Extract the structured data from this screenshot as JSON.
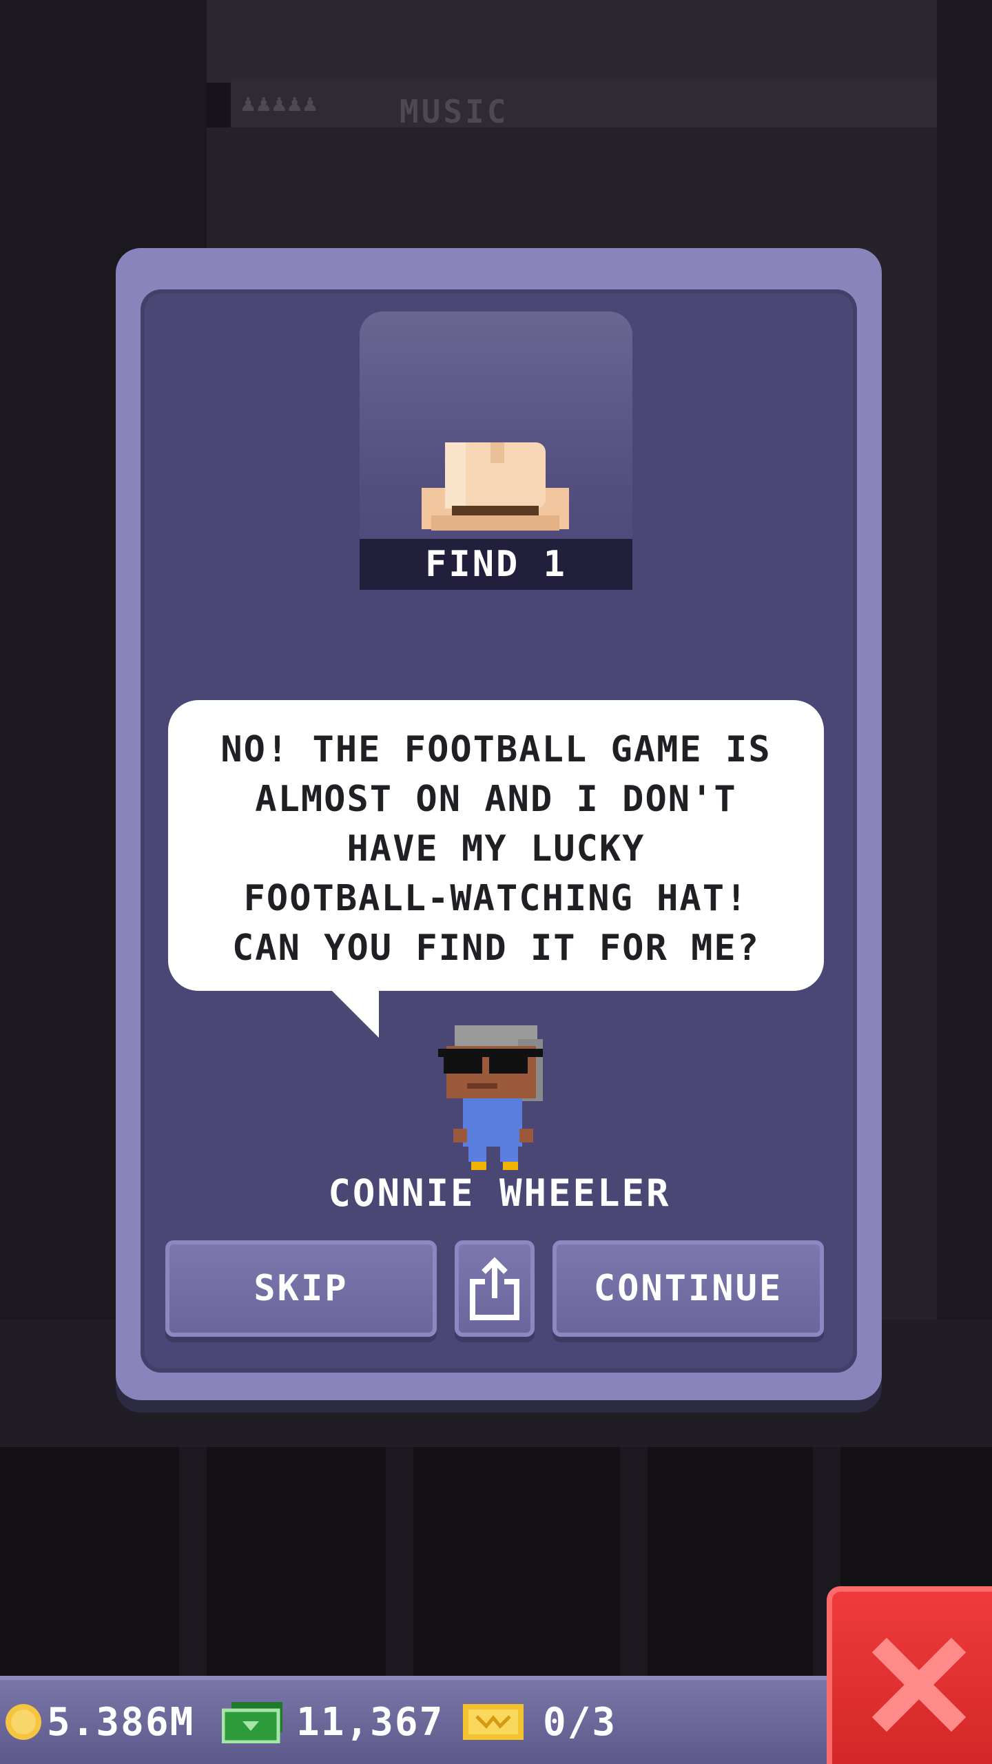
{
  "background": {
    "floor_label": "MUSIC",
    "floor_people": "♟♟♟♟♟"
  },
  "quest": {
    "item_icon": "cowboy-hat-icon",
    "find_label": "FIND 1",
    "dialogue": "NO! THE FOOTBALL GAME IS\nALMOST ON AND I DON'T\nHAVE MY LUCKY\nFOOTBALL-WATCHING HAT!\nCAN YOU FIND IT FOR ME?",
    "npc_name": "CONNIE WHEELER"
  },
  "buttons": {
    "skip": "SKIP",
    "share_icon": "share-icon",
    "continue": "CONTINUE"
  },
  "status_bar": {
    "coins": "5.386M",
    "bux": "11,367",
    "tickets": "0/3"
  },
  "colors": {
    "card_border": "#8a84bd",
    "card_fill": "#4b4775",
    "label_bar": "#211f3c",
    "close_red": "#e03030",
    "coin": "#f5c542",
    "bux": "#2e9b3a"
  }
}
